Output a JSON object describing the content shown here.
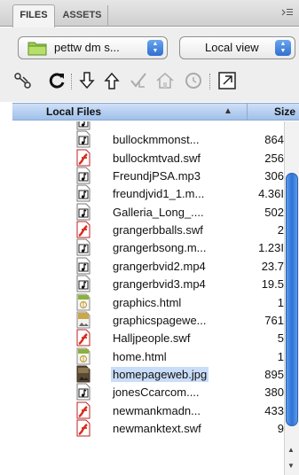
{
  "tabs": [
    {
      "label": "FILES",
      "active": true
    },
    {
      "label": "ASSETS",
      "active": false
    }
  ],
  "panel_menu_icon": "panel-options-menu-icon",
  "toolbar": {
    "site_select": "pettw dm s...",
    "view_select": "Local view",
    "icons": [
      "connect-icon",
      "refresh-icon",
      "get-files-icon",
      "put-files-icon",
      "check-out-icon",
      "check-in-icon",
      "synchronize-icon",
      "expand-icon"
    ]
  },
  "list_header": {
    "name": "Local Files",
    "sort": "▲",
    "size": "Size"
  },
  "files": [
    {
      "name": "",
      "size": "",
      "type": "audio",
      "partial": true
    },
    {
      "name": "bullockmmonst...",
      "size": "864",
      "type": "audio"
    },
    {
      "name": "bullockmtvad.swf",
      "size": "256",
      "type": "flash"
    },
    {
      "name": "FreundjPSA.mp3",
      "size": "306",
      "type": "audio"
    },
    {
      "name": "freundjvid1_1.m...",
      "size": "4.36I",
      "type": "audio"
    },
    {
      "name": "Galleria_Long_....",
      "size": "502",
      "type": "audio"
    },
    {
      "name": "grangerbballs.swf",
      "size": "2",
      "type": "flash"
    },
    {
      "name": "grangerbsong.m...",
      "size": "1.23I",
      "type": "audio"
    },
    {
      "name": "grangerbvid2.mp4",
      "size": "23.7",
      "type": "audio"
    },
    {
      "name": "grangerbvid3.mp4",
      "size": "19.5",
      "type": "audio"
    },
    {
      "name": "graphics.html",
      "size": "1",
      "type": "html"
    },
    {
      "name": "graphicspagewe...",
      "size": "761",
      "type": "image"
    },
    {
      "name": "Halljpeople.swf",
      "size": "5",
      "type": "flash"
    },
    {
      "name": "home.html",
      "size": "1",
      "type": "html"
    },
    {
      "name": "homepageweb.jpg",
      "size": "895",
      "type": "image-dark",
      "selected": true
    },
    {
      "name": "jonesCcarcom....",
      "size": "380",
      "type": "audio"
    },
    {
      "name": "newmankmadn...",
      "size": "433",
      "type": "flash"
    },
    {
      "name": "newmanktext.swf",
      "size": "9",
      "type": "flash"
    }
  ],
  "colors": {
    "header": "#9fc0ea",
    "selection": "#c9ddf8",
    "scroll_thumb": "#2f72d6",
    "flash_red": "#d92b1e",
    "html_green": "#8ab23a"
  }
}
